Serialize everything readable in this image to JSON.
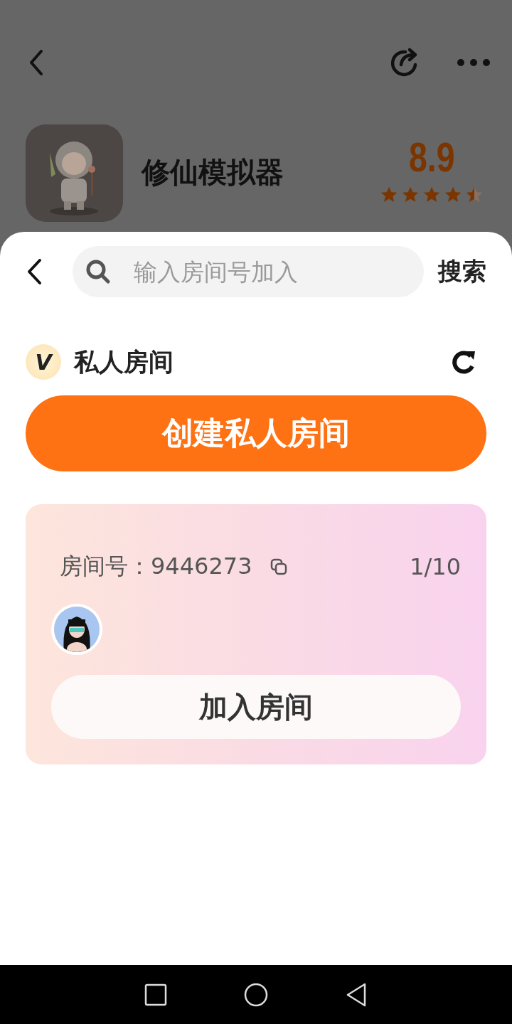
{
  "header": {
    "game_title": "修仙模拟器",
    "score": "8.9",
    "stars": 4.5
  },
  "sheet": {
    "search": {
      "placeholder": "输入房间号加入"
    },
    "search_button": "搜索",
    "section": {
      "badge": "V",
      "title": "私人房间"
    },
    "create_button": "创建私人房间",
    "rooms": [
      {
        "room_label": "房间号：",
        "room_number": "9446273",
        "occupancy": "1/10",
        "join_button": "加入房间"
      }
    ]
  }
}
